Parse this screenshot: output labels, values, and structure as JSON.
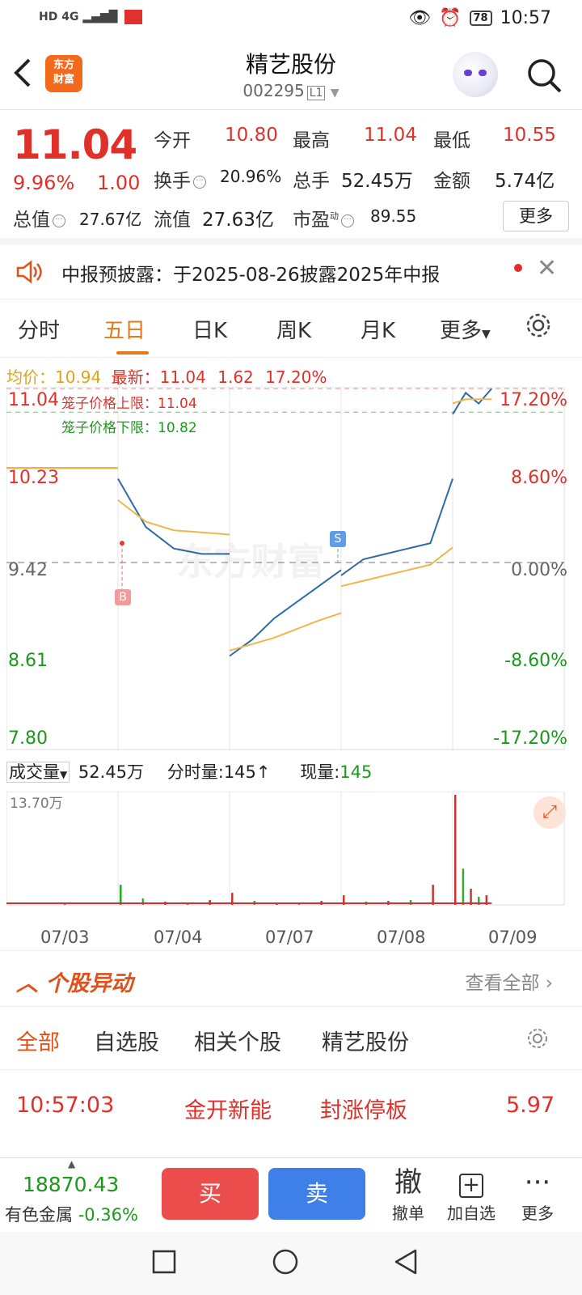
{
  "status": {
    "left": "HD 4G",
    "battery": "78",
    "time": "10:57"
  },
  "header": {
    "title": "精艺股份",
    "code": "002295",
    "level": "L1",
    "logo_line1": "东方",
    "logo_line2": "财富"
  },
  "quote": {
    "price": "11.04",
    "pct": "9.96%",
    "change": "1.00",
    "open_label": "今开",
    "open": "10.80",
    "high_label": "最高",
    "high": "11.04",
    "low_label": "最低",
    "low": "10.55",
    "turnover_label": "换手",
    "turnover": "20.96%",
    "volume_label": "总手",
    "volume": "52.45万",
    "amount_label": "金额",
    "amount": "5.74亿",
    "mktcap_label": "总值",
    "mktcap": "27.67亿",
    "float_label": "流值",
    "float": "27.63亿",
    "pe_label": "市盈",
    "pe_sup": "动",
    "pe": "89.55",
    "more": "更多"
  },
  "notice": {
    "text": "中报预披露：于2025-08-26披露2025年中报"
  },
  "tabs": [
    "分时",
    "五日",
    "日K",
    "周K",
    "月K",
    "更多"
  ],
  "legend": {
    "avg_label": "均价：",
    "avg": "10.94",
    "last_label": "最新：",
    "last": "11.04",
    "chg": "1.62",
    "pct": "17.20%"
  },
  "chart_labels": {
    "upper_limit": "笼子价格上限：11.04",
    "lower_limit": "笼子价格下限：10.82",
    "marker_b": "B",
    "marker_s": "S",
    "watermark": "东方财富"
  },
  "chart_data": {
    "type": "line",
    "x": [
      "07/03",
      "07/04",
      "07/07",
      "07/08",
      "07/09"
    ],
    "y_left_ticks": [
      "11.04",
      "10.23",
      "9.42",
      "8.61",
      "7.80"
    ],
    "y_right_ticks": [
      "17.20%",
      "8.60%",
      "0.00%",
      "-8.60%",
      "-17.20%"
    ],
    "ylim": [
      7.8,
      11.04
    ],
    "prev_close": 9.42,
    "series": [
      {
        "name": "最新",
        "day_values": [
          [
            10.3,
            10.3
          ],
          [
            10.2,
            9.75,
            9.55,
            9.5,
            9.5
          ],
          [
            8.55,
            8.7,
            8.9,
            9.05,
            9.2,
            9.35
          ],
          [
            9.3,
            9.45,
            9.5,
            9.55,
            9.6,
            10.2
          ],
          [
            10.8,
            11.0,
            10.9,
            11.04
          ]
        ]
      },
      {
        "name": "均价",
        "day_values": [
          [
            10.3,
            10.3
          ],
          [
            10.0,
            9.8,
            9.72,
            9.7,
            9.68
          ],
          [
            8.6,
            8.66,
            8.72,
            8.8,
            8.88,
            8.95
          ],
          [
            9.2,
            9.25,
            9.3,
            9.35,
            9.4,
            9.56
          ],
          [
            10.9,
            10.94,
            10.94,
            10.94
          ]
        ]
      }
    ]
  },
  "volume": {
    "label": "成交量",
    "total": "52.45万",
    "tick_label": "分时量:",
    "tick_value": "145",
    "now_label": "现量:",
    "now_value": "145",
    "max": "13.70万"
  },
  "volume_data": {
    "max": 13.7,
    "day_spikes": [
      [
        0,
        0.2
      ],
      [
        2.5,
        0.8,
        0.4,
        0.3,
        0.6
      ],
      [
        1.5,
        0.5,
        0.3,
        0.2,
        0.5
      ],
      [
        1.2,
        0.4,
        0.5,
        0.6,
        2.5
      ],
      [
        13.7,
        4.5,
        2.0,
        1.0,
        1.2
      ]
    ]
  },
  "movers": {
    "title": "个股异动",
    "view_all": "查看全部",
    "tabs": [
      "全部",
      "自选股",
      "相关个股",
      "精艺股份"
    ],
    "row": {
      "time": "10:57:03",
      "name": "金开新能",
      "event": "封涨停板",
      "value": "5.97"
    }
  },
  "bottom": {
    "index_value": "18870.43",
    "index_name": "有色金属",
    "index_pct": "-0.36%",
    "buy": "买",
    "sell": "卖",
    "cancel_icon": "撤",
    "cancel": "撤单",
    "add": "加自选",
    "more": "更多"
  }
}
